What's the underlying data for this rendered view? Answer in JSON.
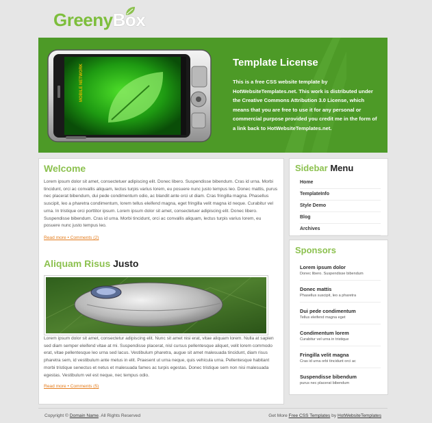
{
  "logo": {
    "part1": "Greeny",
    "part2": "Box"
  },
  "banner": {
    "title": "Template License",
    "text": "This is a free CSS website template by HotWebsiteTemplates.net. This work is distributed under the Creative Commons Attribution 3.0 License, which means that you are free to use it for any personal or commercial purpose provided you credit me in the form of a link back to HotWebsiteTemplates.net.",
    "phone_label": "MOBILE NETWORK"
  },
  "main": {
    "welcome_title": "Welcome",
    "welcome_text": "Lorem ipsum dolor sit amet, consectetuer adipiscing elit. Donec libero. Suspendisse bibendum. Cras id urna. Morbi tincidunt, orci ac convallis aliquam, lectus turpis varius lorem, eu posuere nunc justo tempus leo. Donec mattis, purus nec placerat bibendum, dui pede condimentum odio, ac blandit ante orci ut diam. Cras fringilla magna. Phasellus suscipit, leo a pharetra condimentum, lorem tellus eleifend magna, eget fringilla velit magna id neque. Curabitur vel urna. In tristique orci porttitor ipsum. Lorem ipsum dolor sit amet, consectetuer adipiscing elit. Donec libero. Suspendisse bibendum. Cras id urna. Morbi tincidunt, orci ac convallis aliquam, lectus turpis varius lorem, eu posuere nunc justo tempus leo.",
    "welcome_link": "Read more • Comments (2)",
    "article_title_green": "Aliquam Risus",
    "article_title_dark": "Justo",
    "article_text": "Lorem ipsum dolor sit amet, consectetur adipiscing elit. Nunc sit amet nisi erat, vitae aliquam lorem. Nulla at sapien sed diam semper eleifend vitae at mi. Suspendisse placerat, nisl cursus pellentesque aliquet, velit lorem commodo erat, vitae pellentesque leo urna sed lacus. Vestibulum pharetra, augue sit amet malesuada tincidunt, diam risus pharetra sem, id vestibulum ante metus in elit. Praesent ut urna neque, quis vehicula urna. Pellentesque habitant morbi tristique senectus et netus et malesuada fames ac turpis egestas. Donec tristique sem non nisi malesuada egestas. Vestibulum vel est neque, nec tempus odio.",
    "article_link": "Read more • Comments (5)"
  },
  "sidebar": {
    "title_green": "Sidebar",
    "title_dark": "Menu",
    "items": [
      "Home",
      "TemplateInfo",
      "Style Demo",
      "Blog",
      "Archives"
    ]
  },
  "sponsors": {
    "title": "Sponsors",
    "items": [
      {
        "title": "Lorem ipsum dolor",
        "desc": "Donec libero. Suspendisse bibendum"
      },
      {
        "title": "Donec mattis",
        "desc": "Phasellus suscipit, leo a pharetra"
      },
      {
        "title": "Dui pede condimentum",
        "desc": "Tellus eleifend magna eget"
      },
      {
        "title": "Condimentum lorem",
        "desc": "Curabitur vel urna in tristique"
      },
      {
        "title": "Fringilla velit magna",
        "desc": "Cras id urna orbi tincidunt orci ac"
      },
      {
        "title": "Suspendisse bibendum",
        "desc": "purus nec placerat bibendum"
      }
    ]
  },
  "footer": {
    "copyright_prefix": "Copyright ©",
    "copyright_link": "Domain Name",
    "copyright_suffix": ". All Rights Reserved",
    "right_prefix": "Get More",
    "right_link1": "Free CSS Templates",
    "right_mid": "by",
    "right_link2": "HotWebsiteTemplates"
  },
  "colors": {
    "accent_green": "#8cc14f",
    "banner_green": "#4d9a27",
    "link_orange": "#e37b1b"
  }
}
